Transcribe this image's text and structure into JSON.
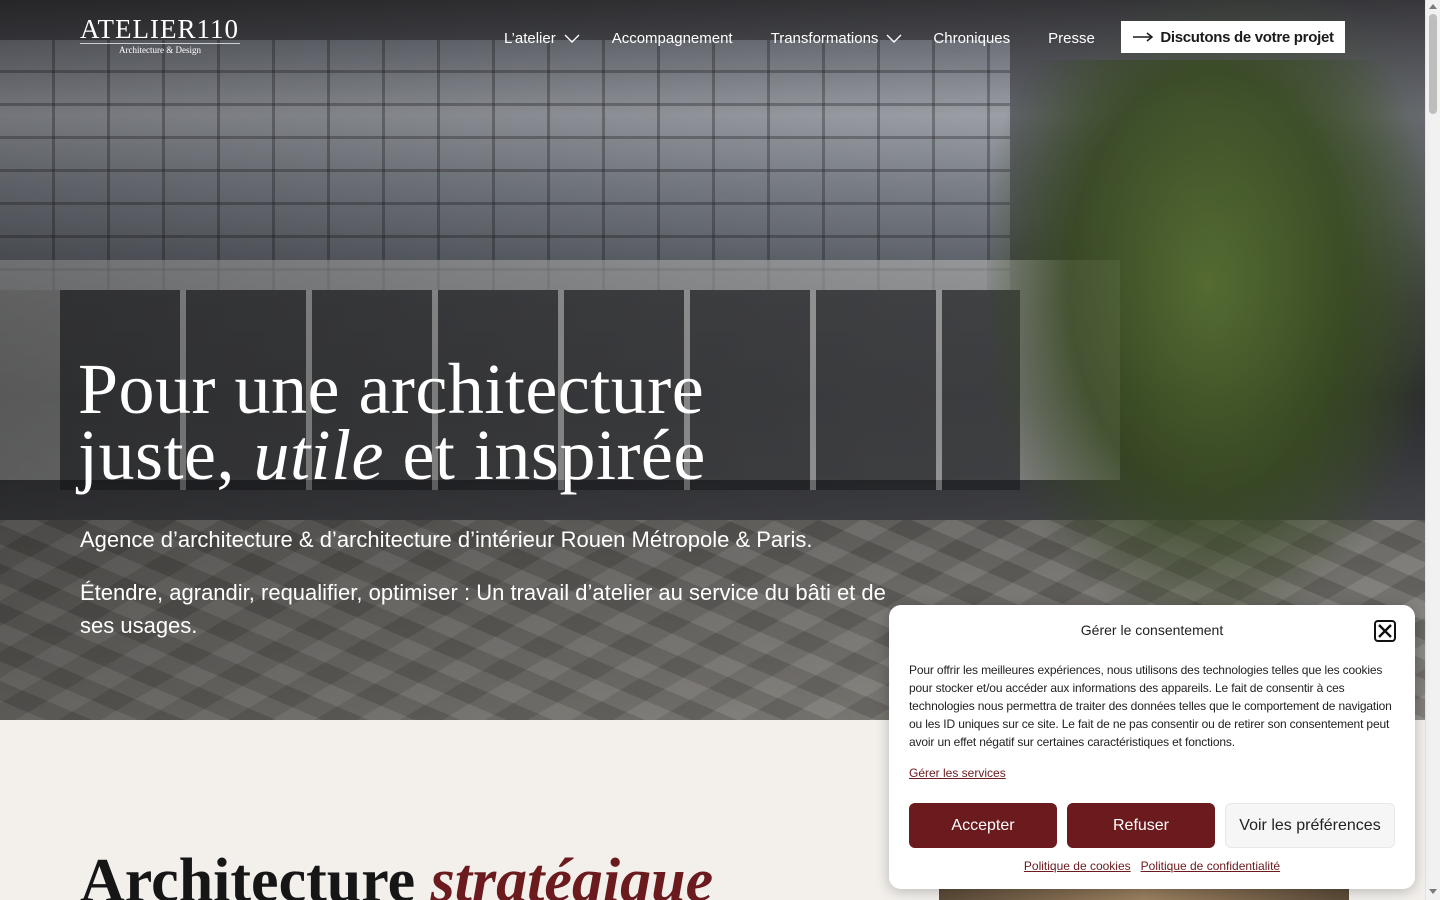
{
  "header": {
    "logo_main": "ATELIER110",
    "logo_sub": "Architecture & Design",
    "nav": [
      {
        "label": "L’atelier",
        "has_dropdown": true
      },
      {
        "label": "Accompagnement",
        "has_dropdown": false
      },
      {
        "label": "Transformations",
        "has_dropdown": true
      },
      {
        "label": "Chroniques",
        "has_dropdown": false
      },
      {
        "label": "Presse",
        "has_dropdown": false
      }
    ],
    "cta_label": "Discutons de votre projet"
  },
  "hero": {
    "title_line1": "Pour une architecture",
    "title_line2_a": "juste, ",
    "title_line2_em": "utile",
    "title_line2_b": " et inspirée",
    "subtitle1": "Agence d’architecture & d’architecture d’intérieur Rouen Métropole & Paris.",
    "subtitle2": "Étendre, agrandir, requalifier, optimiser : Un travail d’atelier au service du bâti et de ses usages."
  },
  "section": {
    "title_a": "Architecture ",
    "title_em": "stratégique"
  },
  "consent": {
    "title": "Gérer le consentement",
    "text": "Pour offrir les meilleures expériences, nous utilisons des technologies telles que les cookies pour stocker et/ou accéder aux informations des appareils. Le fait de consentir à ces technologies nous permettra de traiter des données telles que le comportement de navigation ou les ID uniques sur ce site. Le fait de ne pas consentir ou de retirer son consentement peut avoir un effet négatif sur certaines caractéristiques et fonctions.",
    "manage_label": "Gérer les services",
    "accept_label": "Accepter",
    "refuse_label": "Refuser",
    "prefs_label": "Voir les préférences",
    "cookie_policy_label": "Politique de cookies",
    "privacy_policy_label": "Politique de confidentialité"
  },
  "colors": {
    "accent": "#6b1a1e",
    "background": "#f3f0ec"
  },
  "icons": [
    "chevron-down-icon",
    "arrow-right-icon",
    "close-icon"
  ]
}
